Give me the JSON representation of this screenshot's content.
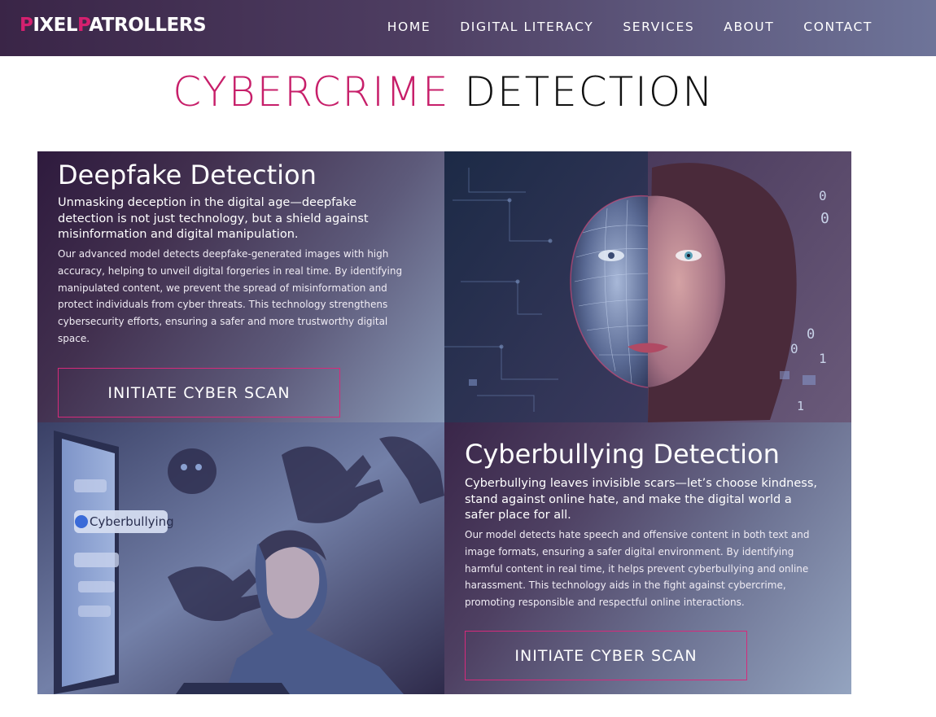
{
  "header": {
    "logo": {
      "part1": "P",
      "part2": "IXEL",
      "part3": "P",
      "part4": "ATROLLERS"
    },
    "nav": [
      {
        "label": "HOME"
      },
      {
        "label": "DIGITAL LITERACY"
      },
      {
        "label": "SERVICES"
      },
      {
        "label": "ABOUT"
      },
      {
        "label": "CONTACT"
      }
    ]
  },
  "page_title": {
    "accent": "CYBERCRIME",
    "rest": "DETECTION"
  },
  "deepfake": {
    "title": "Deepfake Detection",
    "subtitle": "Unmasking deception in the digital age—deepfake detection is not just technology, but a shield against misinformation and digital manipulation.",
    "body": "Our advanced model detects deepfake-generated images with high accuracy, helping to unveil digital forgeries in real time. By identifying manipulated content, we prevent the spread of misinformation and protect individuals from cyber threats. This technology strengthens cybersecurity efforts, ensuring a safer and more trustworthy digital space.",
    "button": "INITIATE CYBER SCAN"
  },
  "cyberbullying": {
    "title": "Cyberbullying Detection",
    "subtitle": "Cyberbullying leaves invisible scars—let’s choose kindness, stand against online hate, and make the digital world a safer place for all.",
    "body": "Our model detects hate speech and offensive content in both text and image formats, ensuring a safer digital environment. By identifying harmful content in real time, it helps prevent cyberbullying and online harassment. This technology aids in the fight against cybercrime, promoting responsible and respectful online interactions.",
    "button": "INITIATE CYBER SCAN"
  },
  "deepfake_image": {
    "binary": [
      "0",
      "0",
      "0",
      "0",
      "1",
      "1"
    ]
  },
  "bullying_image": {
    "screen_label": "Cyberbullying"
  },
  "colors": {
    "accent": "#d4206f",
    "header_start": "#3a2547",
    "header_end": "#6e7499"
  }
}
